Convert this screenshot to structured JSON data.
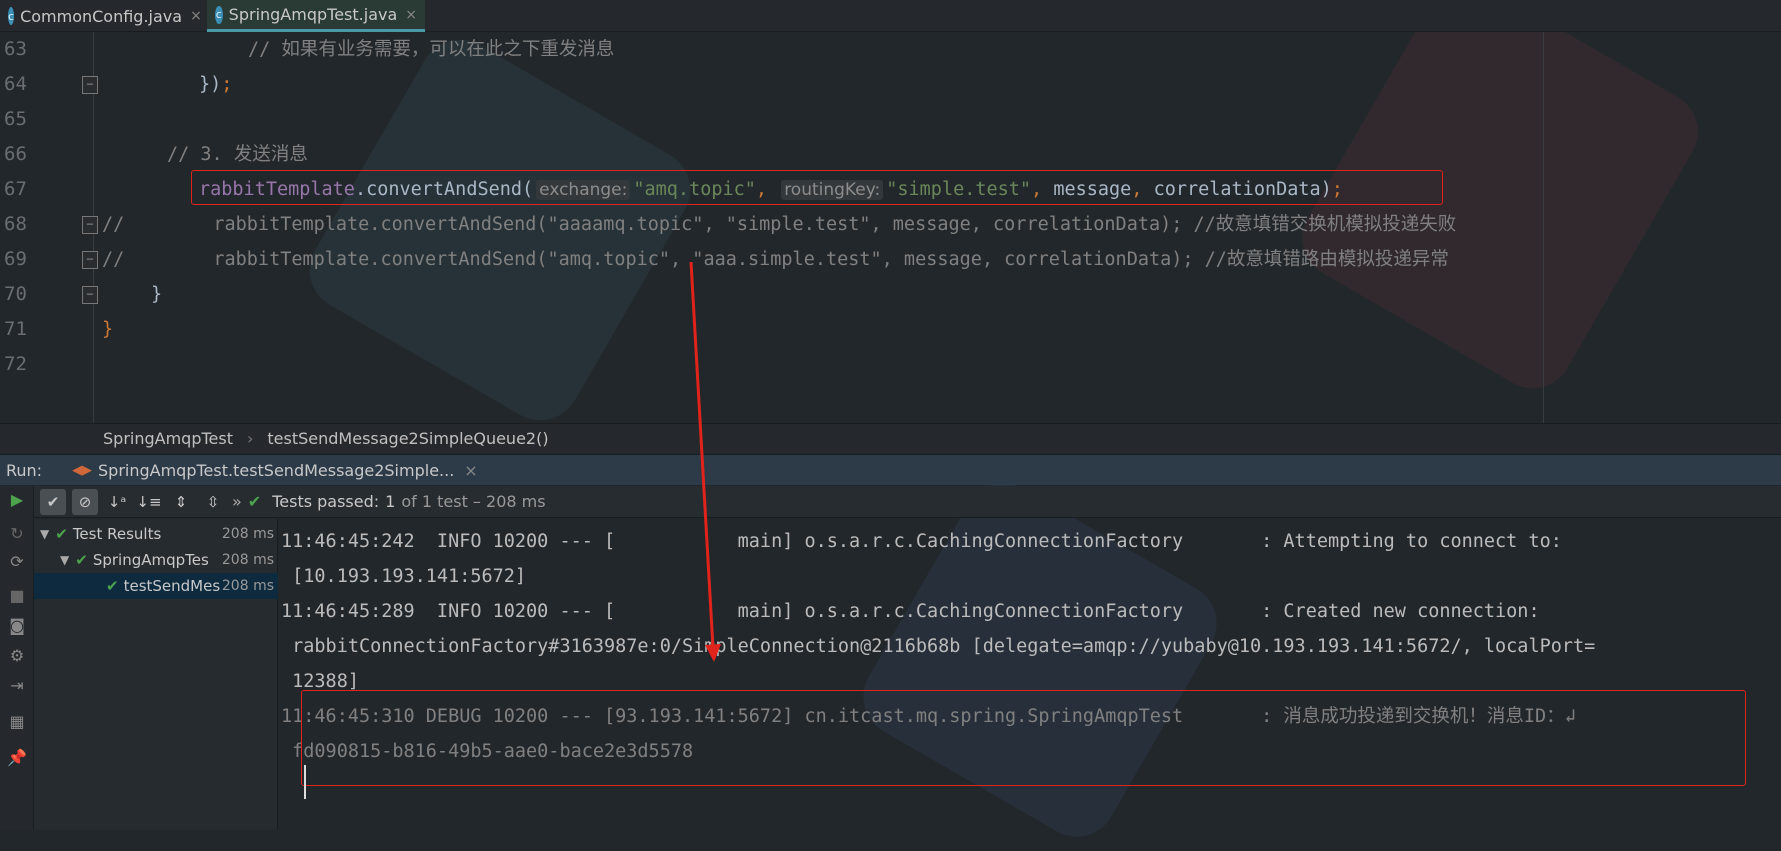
{
  "tabs": [
    {
      "label": "CommonConfig.java",
      "icon": "class-icon",
      "active": false
    },
    {
      "label": "SpringAmqpTest.java",
      "icon": "test-class-icon",
      "active": true
    }
  ],
  "editor": {
    "lines": [
      {
        "num": "63",
        "indent": 248,
        "fold": false,
        "tokens": [
          {
            "c": "t-cmt",
            "t": "// 如果有业务需要，可以在此之下重发消息"
          }
        ]
      },
      {
        "num": "64",
        "indent": 199,
        "fold": true,
        "tokens": [
          {
            "c": "t-plain",
            "t": "})"
          },
          {
            "c": "t-punc",
            "t": ";"
          }
        ]
      },
      {
        "num": "65",
        "indent": 199,
        "fold": false,
        "tokens": []
      },
      {
        "num": "66",
        "indent": 167,
        "fold": false,
        "tokens": [
          {
            "c": "t-cmt",
            "t": "// 3. 发送消息"
          }
        ]
      },
      {
        "num": "67",
        "indent": 199,
        "fold": false,
        "tokens": [
          {
            "c": "t-field",
            "t": "rabbitTemplate"
          },
          {
            "c": "t-plain",
            "t": ".convertAndSend("
          },
          {
            "c": "t-hint",
            "t": "exchange:"
          },
          {
            "c": "t-str",
            "t": "\"amq.topic\""
          },
          {
            "c": "t-punc",
            "t": ", "
          },
          {
            "c": "t-hint",
            "t": "routingKey:"
          },
          {
            "c": "t-str",
            "t": "\"simple.test\""
          },
          {
            "c": "t-punc",
            "t": ", "
          },
          {
            "c": "t-plain",
            "t": "message"
          },
          {
            "c": "t-punc",
            "t": ", "
          },
          {
            "c": "t-plain",
            "t": "correlationData)"
          },
          {
            "c": "t-punc",
            "t": ";"
          }
        ]
      },
      {
        "num": "68",
        "indent": 102,
        "fold": true,
        "tokens": [
          {
            "c": "t-cmt",
            "t": "//        rabbitTemplate.convertAndSend(\"aaaamq.topic\", \"simple.test\", message, correlationData); //故意填错交换机模拟投递失败"
          }
        ]
      },
      {
        "num": "69",
        "indent": 102,
        "fold": true,
        "tokens": [
          {
            "c": "t-cmt",
            "t": "//        rabbitTemplate.convertAndSend(\"amq.topic\", \"aaa.simple.test\", message, correlationData); //故意填错路由模拟投递异常"
          }
        ]
      },
      {
        "num": "70",
        "indent": 151,
        "fold": true,
        "tokens": [
          {
            "c": "t-plain",
            "t": "}"
          }
        ]
      },
      {
        "num": "71",
        "indent": 102,
        "fold": false,
        "tokens": [
          {
            "c": "t-punc",
            "t": "}"
          }
        ]
      },
      {
        "num": "72",
        "indent": 102,
        "fold": false,
        "tokens": []
      }
    ]
  },
  "breadcrumb": {
    "items": [
      "SpringAmqpTest",
      "testSendMessage2SimpleQueue2()"
    ],
    "separator": "›"
  },
  "run": {
    "label": "Run:",
    "config": "SpringAmqpTest.testSendMessage2Simple...",
    "close": "×"
  },
  "toolbar": {
    "status_prefix": "Tests passed:",
    "status_count": "1",
    "status_suffix": "of 1 test – 208 ms",
    "more": "»"
  },
  "tree": [
    {
      "label": "Test Results",
      "time": "208 ms",
      "level": 0,
      "expanded": true
    },
    {
      "label": "SpringAmqpTes",
      "time": "208 ms",
      "level": 1,
      "expanded": true
    },
    {
      "label": "testSendMes",
      "time": "208 ms",
      "level": 2,
      "selected": true
    }
  ],
  "console": {
    "lines": [
      {
        "c": "c-info",
        "t": "11:46:45:242  INFO 10200 --- [           main] o.s.a.r.c.CachingConnectionFactory       : Attempting to connect to:"
      },
      {
        "c": "c-info",
        "t": " [10.193.193.141:5672]"
      },
      {
        "c": "c-info",
        "t": "11:46:45:289  INFO 10200 --- [           main] o.s.a.r.c.CachingConnectionFactory       : Created new connection:"
      },
      {
        "c": "c-info",
        "t": " rabbitConnectionFactory#3163987e:0/SimpleConnection@2116b68b [delegate=amqp://yubaby@10.193.193.141:5672/, localPort="
      },
      {
        "c": "c-info",
        "t": " 12388]"
      },
      {
        "c": "c-debug",
        "t": "11:46:45:310 DEBUG 10200 --- [93.193.141:5672] cn.itcast.mq.spring.SpringAmqpTest       : 消息成功投递到交换机！消息ID：↲"
      },
      {
        "c": "c-debug",
        "t": " fd090815-b816-49b5-aae0-bace2e3d5578"
      }
    ]
  },
  "colors": {
    "highlight_box": "#e0241b",
    "arrow": "#e0241b",
    "pass": "#4ca34c"
  }
}
